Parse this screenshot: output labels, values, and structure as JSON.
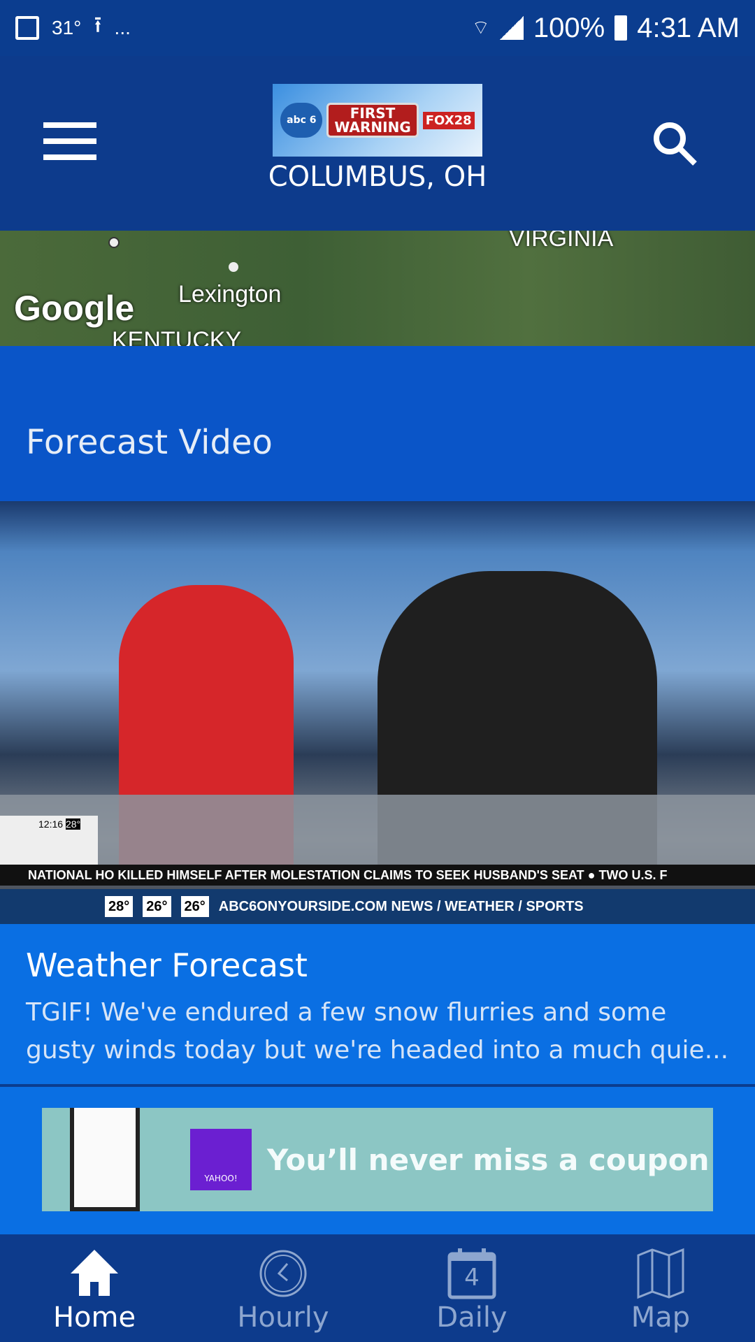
{
  "status": {
    "temp": "31°",
    "more": "...",
    "battery": "100%",
    "time": "4:31 AM"
  },
  "header": {
    "logo": "abc 6 FIRST WARNING FOX 28",
    "location": "COLUMBUS, OH"
  },
  "map": {
    "labels": [
      "VIRGINIA",
      "Lexington",
      "KENTUCKY"
    ],
    "attribution": "Google"
  },
  "forecast_video": {
    "title": "Forecast Video",
    "overlay": {
      "clock": "12:16",
      "temp": "28°",
      "ticker": "NATIONAL  HO KILLED HIMSELF AFTER MOLESTATION CLAIMS TO SEEK HUSBAND'S SEAT   ●   TWO U.S. F",
      "temps": [
        "28°",
        "26°",
        "26°"
      ],
      "site": "ABC6ONYOURSIDE.COM NEWS / WEATHER / SPORTS"
    }
  },
  "card": {
    "title": "Weather Forecast",
    "summary": "TGIF! We've endured a few snow flurries and some gusty winds today but we're headed into a much quie..."
  },
  "ad": {
    "text": "You’ll never miss a coupon",
    "brand": "YAHOO!"
  },
  "nav": [
    {
      "label": "Home",
      "icon": "home-icon",
      "active": true
    },
    {
      "label": "Hourly",
      "icon": "clock-icon"
    },
    {
      "label": "Daily",
      "icon": "calendar-icon",
      "day": "4"
    },
    {
      "label": "Map",
      "icon": "map-icon"
    }
  ]
}
